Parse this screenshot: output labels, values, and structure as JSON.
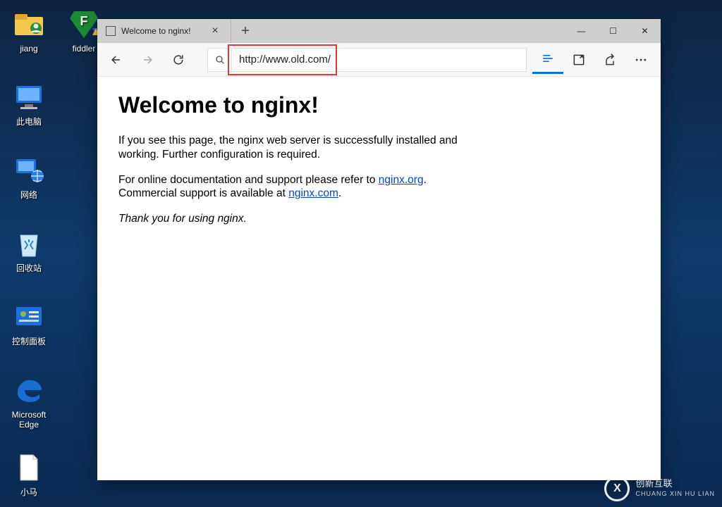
{
  "desktop": {
    "icons": [
      {
        "label": "jiang"
      },
      {
        "label": "fiddler"
      },
      {
        "label": "此电脑"
      },
      {
        "label": "网络"
      },
      {
        "label": "回收站"
      },
      {
        "label": "控制面板"
      },
      {
        "label": "Microsoft Edge"
      },
      {
        "label": "小马"
      }
    ]
  },
  "browser": {
    "tab_title": "Welcome to nginx!",
    "address": "http://www.old.com/",
    "window_controls": {
      "minimize": "—",
      "maximize": "☐",
      "close": "✕"
    },
    "new_tab_label": "+",
    "tab_close_label": "×"
  },
  "page": {
    "heading": "Welcome to nginx!",
    "p1": "If you see this page, the nginx web server is successfully installed and working. Further configuration is required.",
    "p2_a": "For online documentation and support please refer to ",
    "link1_text": "nginx.org",
    "p2_b": ".",
    "p3_a": "Commercial support is available at ",
    "link2_text": "nginx.com",
    "p3_b": ".",
    "thanks": "Thank you for using nginx."
  },
  "watermark": {
    "brand": "创新互联",
    "sub": "CHUANG XIN HU LIAN",
    "mark": "X"
  }
}
